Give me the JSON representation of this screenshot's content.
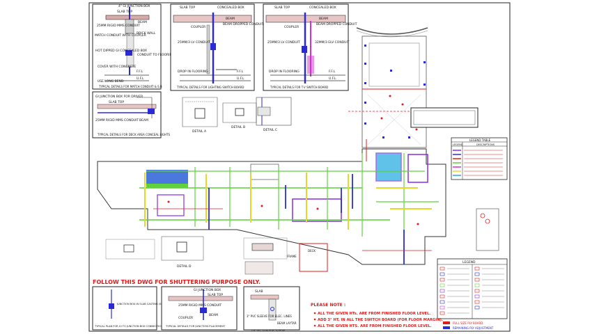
{
  "details": {
    "gi_box": {
      "labels": [
        "4\" GI JUNCTION BOX",
        "SLAB TOP",
        "BEAM",
        "25MM RIGID MMS CONDUIT",
        "BRICK WALL",
        "MATCH CONDUIT WITH COUPLER",
        "HOT DIPPED GI CONCEALED BOX",
        "CONDUIT TO FLOORING",
        "COVER WITH CONCRETE",
        "USE LONG BEND",
        "F.F.L",
        "U.F.L"
      ],
      "caption": "TYPICAL DETAILS FOR MATCH CONDUIT & S.B"
    },
    "lighting_switch": {
      "labels": [
        "SLAB TOP",
        "CONCEALED BOX",
        "BEAM",
        "COUPLER",
        "BEAM DROPPED CONDUIT",
        "25MM/3 LV CONDUIT",
        "DROP IN FLOORING",
        "F.F.L",
        "U.F.L"
      ],
      "caption": "TYPICAL DETAILS FOR LIGHTING SWITCH BOARD"
    },
    "tv_switch": {
      "labels": [
        "SLAB TOP",
        "CONCEALED BOX",
        "BEAM",
        "COUPLER",
        "BEAM DROPPED CONDUIT",
        "25MM/3 LV CONDUIT",
        "32MM/3 ELV CONDUIT",
        "DROP IN FLOORING",
        "F.F.L",
        "U.F.L"
      ],
      "caption": "TYPICAL DETAILS FOR T.V SWITCH BOARD"
    },
    "driver_box": {
      "labels": [
        "GI JUNCTION BOX FOR DRIVER",
        "SLAB TOP",
        "25MM RIGID MMS CONDUIT",
        "BEAM"
      ],
      "caption": "TYPICAL DETAILS FOR DECK AREA CONCEAL LIGHTS"
    },
    "plan_gi": {
      "labels": [
        "JUNCTION BOX IN SLAB CASTING (SIZE AS PER CONSULTANT)"
      ],
      "caption": "TYPICAL PLAN FOR GI TO JUNCTION BOX CONNECTION"
    },
    "junction_placement": {
      "labels": [
        "GI JUNCTION BOX",
        "SLAB TOP",
        "25MM RIGID MMS CONDUIT",
        "COUPLER",
        "BEAM"
      ],
      "caption": "TYPICAL DETAILS FOR JUNCTION PLACEMENT"
    },
    "sleeve": {
      "labels": [
        "SLAB",
        "3\" PVC SLEEVE FOR ELEC. LINES",
        "BEAM LAYTAR"
      ],
      "caption": "TYP SECTION FOR SLEEVE"
    }
  },
  "shuttering_note": "FOLLOW THIS DWG FOR SHUTTERING PURPOSE ONLY.",
  "notes": {
    "title": "PLEASE NOTE :",
    "items": [
      "ALL THE GIVEN HTs. ARE FROM FINISHED FLOOR LEVEL.",
      "ADD 3\" HT. IN ALL THE SWITCH BOARD (FOR FLOOR MARGIN).",
      "ALL THE GIVEN HTS. ARE FROM FINISHED FLOOR LEVEL."
    ]
  },
  "legend_table": {
    "title": "LEGEND TABLE",
    "columns": [
      "LEGEND",
      "DESCRIPTIONS"
    ]
  },
  "legend_main": {
    "title": "LEGEND"
  },
  "bottom_legend": {
    "items": [
      "FULL SIZE PLY BOARD",
      "REMAINING PLY ADJUSTMENT"
    ]
  },
  "small_labels": {
    "detail_a": "DETAIL A",
    "detail_b": "DETAIL B",
    "detail_c": "DETAIL C",
    "detail_d": "DETAIL D",
    "frame_label": "FRAME",
    "deck_label": "DECK"
  },
  "colors": {
    "red": "#e01b1b",
    "green": "#5fd13a",
    "yellow": "#e8d82a",
    "blue": "#2b2bd6",
    "cyan": "#1ea8e0",
    "purple": "#8a2be2",
    "magenta": "#d42fd4",
    "dark": "#1a1a1a"
  }
}
